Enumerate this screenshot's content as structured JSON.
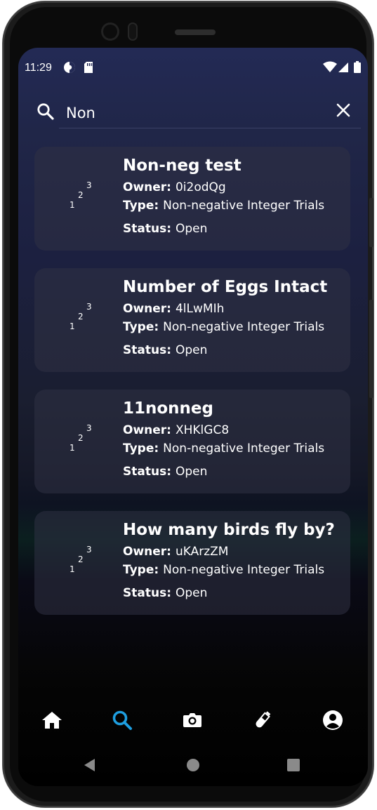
{
  "status_bar": {
    "time": "11:29"
  },
  "search": {
    "value": "Non",
    "placeholder": ""
  },
  "results": [
    {
      "title": "Non-neg test",
      "owner_label": "Owner:",
      "owner": "0i2odQg",
      "type_label": "Type:",
      "type": "Non-negative Integer Trials",
      "status_label": "Status:",
      "status": "Open",
      "icon": "123-icon"
    },
    {
      "title": "Number of Eggs Intact",
      "owner_label": "Owner:",
      "owner": "4lLwMIh",
      "type_label": "Type:",
      "type": "Non-negative Integer Trials",
      "status_label": "Status:",
      "status": "Open",
      "icon": "123-icon"
    },
    {
      "title": "11nonneg",
      "owner_label": "Owner:",
      "owner": "XHKlGC8",
      "type_label": "Type:",
      "type": "Non-negative Integer Trials",
      "status_label": "Status:",
      "status": "Open",
      "icon": "123-icon"
    },
    {
      "title": "How many birds fly by?",
      "owner_label": "Owner:",
      "owner": "uKArzZM",
      "type_label": "Type:",
      "type": "Non-negative Integer Trials",
      "status_label": "Status:",
      "status": "Open",
      "icon": "123-icon"
    }
  ],
  "icon_digits": {
    "one": "1",
    "two": "2",
    "three": "3"
  },
  "bottom_nav": [
    {
      "name": "home-icon",
      "active": false
    },
    {
      "name": "search-icon",
      "active": true
    },
    {
      "name": "camera-icon",
      "active": false
    },
    {
      "name": "test-tube-icon",
      "active": false
    },
    {
      "name": "account-icon",
      "active": false
    }
  ],
  "colors": {
    "accent": "#1e9ee0",
    "text": "#ffffff",
    "card": "#303244"
  }
}
